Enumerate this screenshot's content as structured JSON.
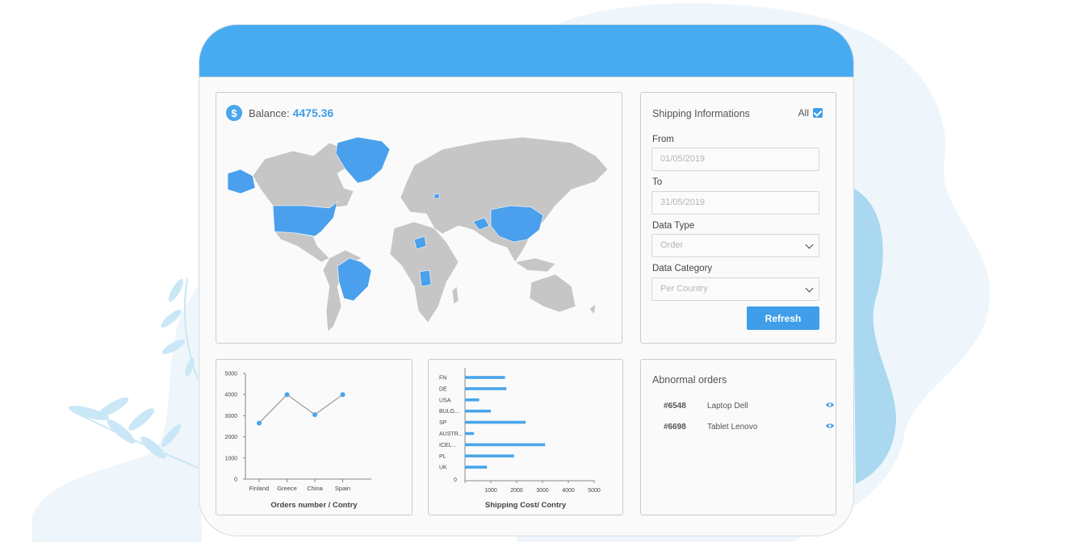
{
  "colors": {
    "accent": "#47abf2",
    "button": "#3f9de9",
    "map_land": "#c6c6c6",
    "map_highlight": "#4aa0ec"
  },
  "balance": {
    "label": "Balance:",
    "value": "4475.36",
    "icon": "dollar-icon"
  },
  "shipping": {
    "title": "Shipping Informations",
    "all_label": "All",
    "all_checked": true,
    "from_label": "From",
    "from_value": "01/05/2019",
    "to_label": "To",
    "to_value": "31/05/2019",
    "data_type_label": "Data Type",
    "data_type_value": "Order",
    "data_category_label": "Data Category",
    "data_category_value": "Per Country",
    "refresh_label": "Refresh"
  },
  "abnormal": {
    "title": "Abnormal orders",
    "orders": [
      {
        "id": "#6548",
        "name": "Laptop Dell",
        "icon": "eye-icon"
      },
      {
        "id": "#6698",
        "name": "Tablet Lenovo",
        "icon": "eye-icon"
      }
    ]
  },
  "map": {
    "highlighted": [
      "Alaska",
      "USA",
      "Greenland",
      "Brazil",
      "Angola",
      "Niger",
      "Afghanistan",
      "China",
      "Switzerland"
    ]
  },
  "chart_data": [
    {
      "type": "line",
      "title": "Orders number / Contry",
      "categories": [
        "Finland",
        "Greece",
        "China",
        "Spain"
      ],
      "values": [
        2650,
        4000,
        3050,
        4000
      ],
      "y_ticks": [
        "0",
        "1000",
        "2000",
        "3000",
        "4000",
        "5000"
      ],
      "ylim": [
        0,
        5000
      ]
    },
    {
      "type": "bar",
      "orientation": "horizontal",
      "title": "Shipping Cost/ Contry",
      "categories": [
        "FN",
        "DE",
        "USA",
        "BULG...",
        "SP",
        "AUSTR...",
        "ICEL...",
        "PL",
        "UK"
      ],
      "values": [
        1550,
        1600,
        550,
        1000,
        2350,
        350,
        3100,
        1900,
        850
      ],
      "x_ticks": [
        "0",
        "1000",
        "2000",
        "3000",
        "4000",
        "5000"
      ],
      "xlim": [
        0,
        5000
      ]
    }
  ]
}
